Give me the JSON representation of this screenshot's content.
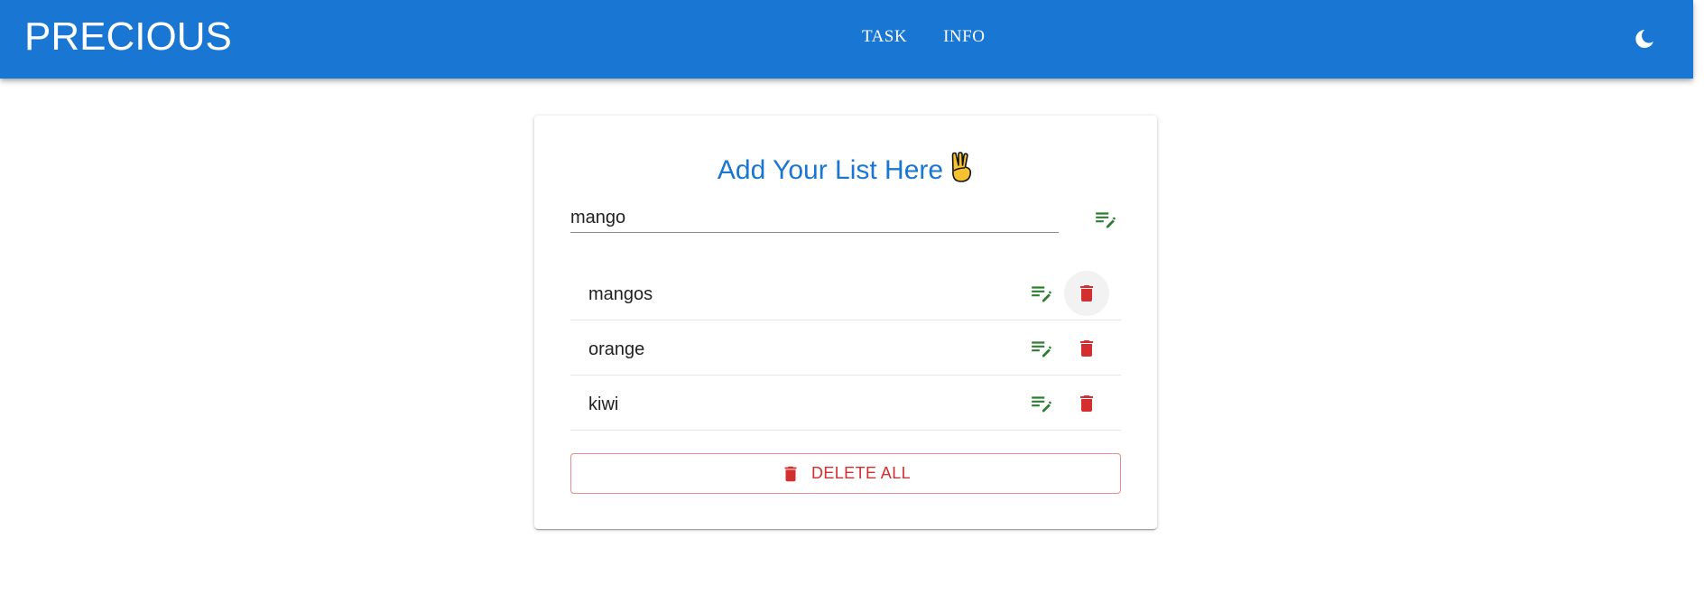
{
  "app": {
    "brand": "PRECIOUS",
    "nav": [
      {
        "label": "TASK"
      },
      {
        "label": "INFO"
      }
    ],
    "theme_icon": "moon-icon"
  },
  "card": {
    "title": "Add Your List Here",
    "title_emoji": "✌",
    "input": {
      "value": "mango",
      "placeholder": ""
    },
    "add_icon": "playlist-edit-icon",
    "items": [
      {
        "label": "mangos"
      },
      {
        "label": "orange"
      },
      {
        "label": "kiwi"
      }
    ],
    "delete_all_label": "DELETE ALL"
  },
  "colors": {
    "appbar": "#1976d2",
    "title": "#1976d2",
    "edit_icon": "#2e7d32",
    "delete": "#d32f2f"
  }
}
